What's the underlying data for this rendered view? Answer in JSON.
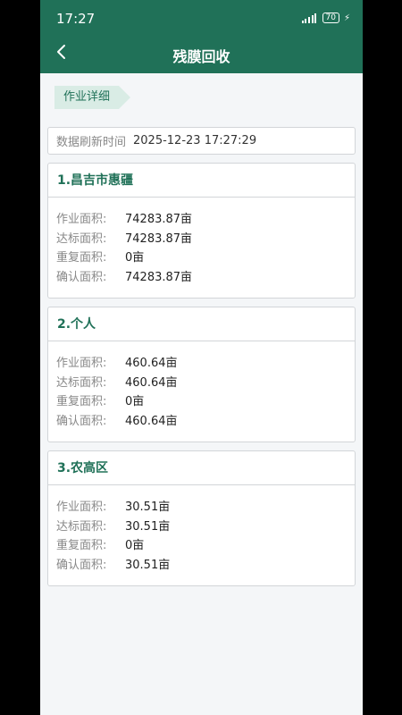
{
  "status_bar": {
    "time": "17:27",
    "battery": "70"
  },
  "header": {
    "title": "残膜回收"
  },
  "section_tag": "作业详细",
  "refresh": {
    "label": "数据刷新时间",
    "value": "2025-12-23 17:27:29"
  },
  "cards": [
    {
      "title": "1.昌吉市惠疆",
      "rows": [
        {
          "label": "作业面积:",
          "value": "74283.87亩"
        },
        {
          "label": "达标面积:",
          "value": "74283.87亩"
        },
        {
          "label": "重复面积:",
          "value": "0亩"
        },
        {
          "label": "确认面积:",
          "value": "74283.87亩"
        }
      ]
    },
    {
      "title": "2.个人",
      "rows": [
        {
          "label": "作业面积:",
          "value": "460.64亩"
        },
        {
          "label": "达标面积:",
          "value": "460.64亩"
        },
        {
          "label": "重复面积:",
          "value": "0亩"
        },
        {
          "label": "确认面积:",
          "value": "460.64亩"
        }
      ]
    },
    {
      "title": "3.农高区",
      "rows": [
        {
          "label": "作业面积:",
          "value": "30.51亩"
        },
        {
          "label": "达标面积:",
          "value": "30.51亩"
        },
        {
          "label": "重复面积:",
          "value": "0亩"
        },
        {
          "label": "确认面积:",
          "value": "30.51亩"
        }
      ]
    }
  ],
  "colors": {
    "primary": "#207158",
    "tag_bg": "#d9ece5",
    "page_bg": "#f4f6f8"
  }
}
